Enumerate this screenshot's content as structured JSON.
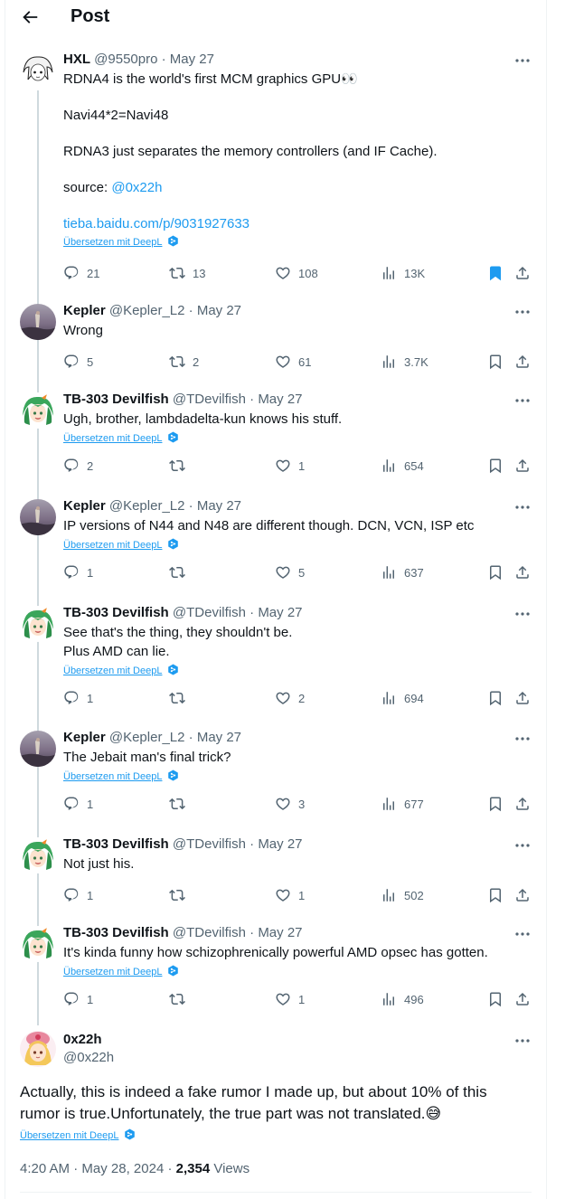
{
  "header": {
    "title": "Post",
    "back_icon": "arrow-left-icon"
  },
  "translate_label": "Übersetzen mit DeepL",
  "replies": [
    {
      "name": "HXL",
      "handle": "@9550pro",
      "date": "May 27",
      "lines": [
        "RDNA4 is the world's first MCM graphics GPU👀",
        "",
        "Navi44*2=Navi48",
        "",
        "RDNA3 just separates the memory controllers (and IF Cache).",
        "",
        "source: @0x22h",
        "",
        "tieba.baidu.com/p/9031927633"
      ],
      "source_prefix": "source: ",
      "source_link": "@0x22h",
      "url_link": "tieba.baidu.com/p/9031927633",
      "has_translate": true,
      "replies_count": "21",
      "reposts_count": "13",
      "likes_count": "108",
      "views_count": "13K",
      "bookmarked": true,
      "avatar": "anime-white-hair"
    },
    {
      "name": "Kepler",
      "handle": "@Kepler_L2",
      "date": "May 27",
      "lines": [
        "Wrong"
      ],
      "has_translate": false,
      "replies_count": "5",
      "reposts_count": "2",
      "likes_count": "61",
      "views_count": "3.7K",
      "bookmarked": false,
      "avatar": "painting"
    },
    {
      "name": "TB-303 Devilfish",
      "handle": "@TDevilfish",
      "date": "May 27",
      "lines": [
        "Ugh, brother, lambdadelta-kun knows his stuff."
      ],
      "has_translate": true,
      "replies_count": "2",
      "reposts_count": "",
      "likes_count": "1",
      "views_count": "654",
      "bookmarked": false,
      "avatar": "anime-green-hair"
    },
    {
      "name": "Kepler",
      "handle": "@Kepler_L2",
      "date": "May 27",
      "lines": [
        "IP versions of N44 and N48 are different though. DCN, VCN, ISP etc"
      ],
      "has_translate": true,
      "replies_count": "1",
      "reposts_count": "",
      "likes_count": "5",
      "views_count": "637",
      "bookmarked": false,
      "avatar": "painting"
    },
    {
      "name": "TB-303 Devilfish",
      "handle": "@TDevilfish",
      "date": "May 27",
      "lines": [
        "See that's the thing, they shouldn't be.",
        "Plus AMD can lie."
      ],
      "has_translate": true,
      "replies_count": "1",
      "reposts_count": "",
      "likes_count": "2",
      "views_count": "694",
      "bookmarked": false,
      "avatar": "anime-green-hair"
    },
    {
      "name": "Kepler",
      "handle": "@Kepler_L2",
      "date": "May 27",
      "lines": [
        "The Jebait man's final trick?"
      ],
      "has_translate": true,
      "replies_count": "1",
      "reposts_count": "",
      "likes_count": "3",
      "views_count": "677",
      "bookmarked": false,
      "avatar": "painting"
    },
    {
      "name": "TB-303 Devilfish",
      "handle": "@TDevilfish",
      "date": "May 27",
      "lines": [
        "Not just his."
      ],
      "has_translate": false,
      "replies_count": "1",
      "reposts_count": "",
      "likes_count": "1",
      "views_count": "502",
      "bookmarked": false,
      "avatar": "anime-green-hair"
    },
    {
      "name": "TB-303 Devilfish",
      "handle": "@TDevilfish",
      "date": "May 27",
      "lines": [
        "It's kinda funny how schizophrenically powerful AMD opsec has gotten."
      ],
      "has_translate": true,
      "replies_count": "1",
      "reposts_count": "",
      "likes_count": "1",
      "views_count": "496",
      "bookmarked": false,
      "avatar": "anime-green-hair"
    }
  ],
  "main_post": {
    "name": "0x22h",
    "handle": "@0x22h",
    "text_line1": "Actually, this is indeed a fake rumor I made up, but about 10% of this",
    "text_line2": "rumor is true.Unfortunately, the true part was not translated.😅",
    "time": "4:20 AM",
    "date": "May 28, 2024",
    "views": "2,354",
    "views_label": "Views",
    "avatar": "anime-blonde-hair"
  },
  "colors": {
    "accent": "#1d9bf0",
    "text": "#0f1419",
    "secondary": "#536471",
    "border": "#eff3f4",
    "thread_line": "#cfd9de"
  },
  "icons": [
    "arrow-left-icon",
    "more-icon",
    "reply-icon",
    "repost-icon",
    "like-icon",
    "views-icon",
    "bookmark-icon",
    "share-icon",
    "deepl-icon"
  ]
}
